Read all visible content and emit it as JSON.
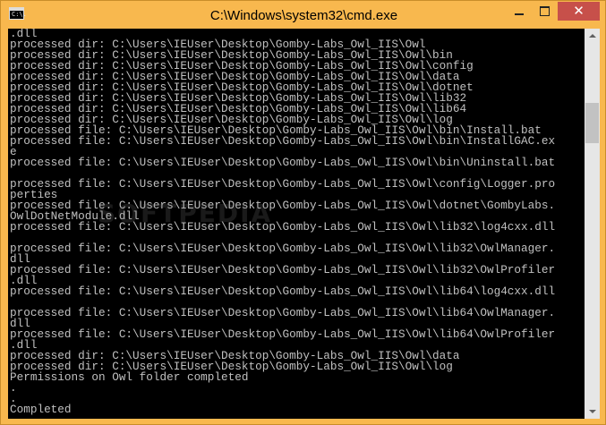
{
  "window": {
    "title": "C:\\Windows\\system32\\cmd.exe",
    "icon": "cmd-icon",
    "icon_text": "C:\\.",
    "close_glyph": "✕",
    "accent": "#f8b84e",
    "close_color": "#c7504a"
  },
  "console": {
    "lines": [
      ".dll",
      "processed dir: C:\\Users\\IEUser\\Desktop\\Gomby-Labs_Owl_IIS\\Owl",
      "processed dir: C:\\Users\\IEUser\\Desktop\\Gomby-Labs_Owl_IIS\\Owl\\bin",
      "processed dir: C:\\Users\\IEUser\\Desktop\\Gomby-Labs_Owl_IIS\\Owl\\config",
      "processed dir: C:\\Users\\IEUser\\Desktop\\Gomby-Labs_Owl_IIS\\Owl\\data",
      "processed dir: C:\\Users\\IEUser\\Desktop\\Gomby-Labs_Owl_IIS\\Owl\\dotnet",
      "processed dir: C:\\Users\\IEUser\\Desktop\\Gomby-Labs_Owl_IIS\\Owl\\lib32",
      "processed dir: C:\\Users\\IEUser\\Desktop\\Gomby-Labs_Owl_IIS\\Owl\\lib64",
      "processed dir: C:\\Users\\IEUser\\Desktop\\Gomby-Labs_Owl_IIS\\Owl\\log",
      "processed file: C:\\Users\\IEUser\\Desktop\\Gomby-Labs_Owl_IIS\\Owl\\bin\\Install.bat",
      "processed file: C:\\Users\\IEUser\\Desktop\\Gomby-Labs_Owl_IIS\\Owl\\bin\\InstallGAC.ex",
      "e",
      "processed file: C:\\Users\\IEUser\\Desktop\\Gomby-Labs_Owl_IIS\\Owl\\bin\\Uninstall.bat",
      "",
      "processed file: C:\\Users\\IEUser\\Desktop\\Gomby-Labs_Owl_IIS\\Owl\\config\\Logger.pro",
      "perties",
      "processed file: C:\\Users\\IEUser\\Desktop\\Gomby-Labs_Owl_IIS\\Owl\\dotnet\\GombyLabs.",
      "OwlDotNetModule.dll",
      "processed file: C:\\Users\\IEUser\\Desktop\\Gomby-Labs_Owl_IIS\\Owl\\lib32\\log4cxx.dll",
      "",
      "processed file: C:\\Users\\IEUser\\Desktop\\Gomby-Labs_Owl_IIS\\Owl\\lib32\\OwlManager.",
      "dll",
      "processed file: C:\\Users\\IEUser\\Desktop\\Gomby-Labs_Owl_IIS\\Owl\\lib32\\OwlProfiler",
      ".dll",
      "processed file: C:\\Users\\IEUser\\Desktop\\Gomby-Labs_Owl_IIS\\Owl\\lib64\\log4cxx.dll",
      "",
      "processed file: C:\\Users\\IEUser\\Desktop\\Gomby-Labs_Owl_IIS\\Owl\\lib64\\OwlManager.",
      "dll",
      "processed file: C:\\Users\\IEUser\\Desktop\\Gomby-Labs_Owl_IIS\\Owl\\lib64\\OwlProfiler",
      ".dll",
      "processed dir: C:\\Users\\IEUser\\Desktop\\Gomby-Labs_Owl_IIS\\Owl\\data",
      "processed dir: C:\\Users\\IEUser\\Desktop\\Gomby-Labs_Owl_IIS\\Owl\\log",
      "Permissions on Owl folder completed",
      ".",
      ".",
      "Completed"
    ],
    "text_color": "#c0c0c0",
    "background": "#000000"
  },
  "watermark": "SOFTPEDIA"
}
